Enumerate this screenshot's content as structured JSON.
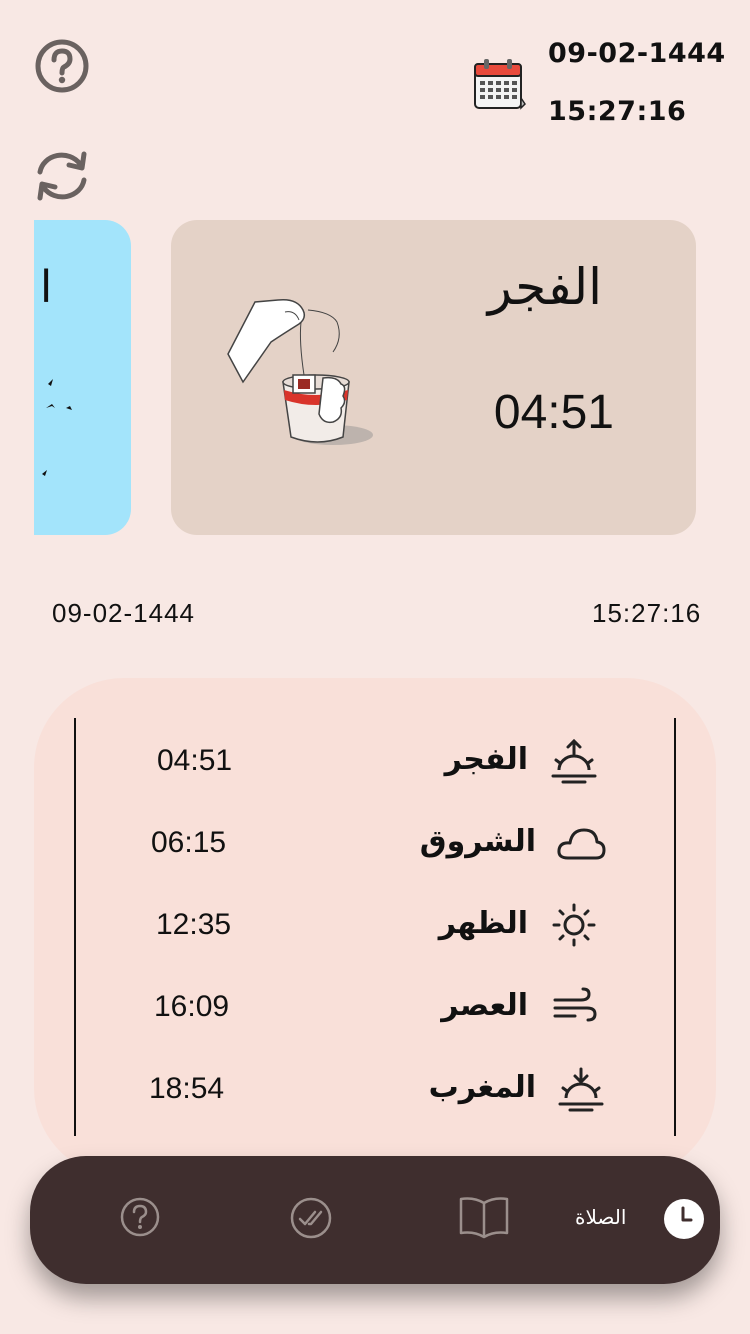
{
  "header": {
    "date": "09-02-1444",
    "time": "15:27:16",
    "icons": [
      "help-circle-icon",
      "refresh-icon",
      "calendar-icon"
    ]
  },
  "cards": {
    "next_card": {
      "text": "ا",
      "color": "#a3e4fb"
    },
    "current": {
      "name": "الفجر",
      "time": "04:51",
      "color": "#e4d2c7",
      "illustration": "tea-cup-illustration"
    }
  },
  "mid": {
    "date": "09-02-1444",
    "time": "15:27:16"
  },
  "prayers": [
    {
      "name": "الفجر",
      "time": "04:51",
      "icon": "sunrise-icon"
    },
    {
      "name": "الشروق",
      "time": "06:15",
      "icon": "cloud-icon"
    },
    {
      "name": "الظهر",
      "time": "12:35",
      "icon": "sun-icon"
    },
    {
      "name": "العصر",
      "time": "16:09",
      "icon": "wind-icon"
    },
    {
      "name": "المغرب",
      "time": "18:54",
      "icon": "sunset-icon"
    }
  ],
  "nav": {
    "active_label": "الصلاة",
    "items": [
      "help-icon",
      "check-circle-icon",
      "book-icon",
      "clock-icon"
    ]
  }
}
